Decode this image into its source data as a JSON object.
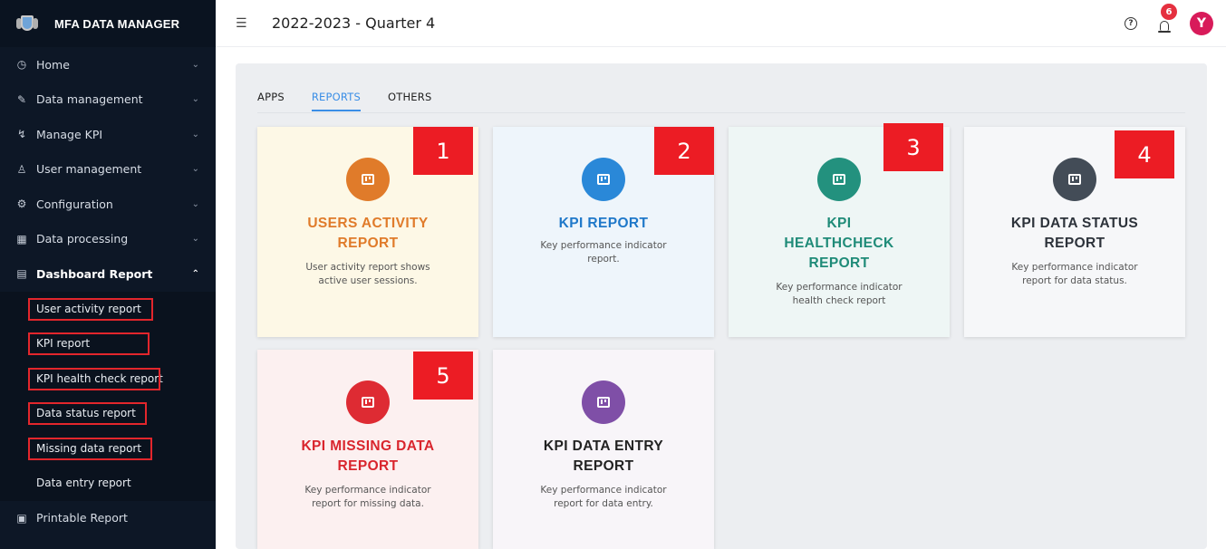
{
  "brand": {
    "title": "MFA DATA MANAGER"
  },
  "topbar": {
    "period": "2022-2023 - Quarter 4",
    "notification_count": "6",
    "avatar_initial": "Y"
  },
  "sidebar": {
    "items": [
      {
        "label": "Home",
        "icon": "clock-icon"
      },
      {
        "label": "Data management",
        "icon": "edit-icon"
      },
      {
        "label": "Manage KPI",
        "icon": "chart-icon"
      },
      {
        "label": "User management",
        "icon": "user-icon"
      },
      {
        "label": "Configuration",
        "icon": "gear-icon"
      },
      {
        "label": "Data processing",
        "icon": "table-icon"
      },
      {
        "label": "Dashboard Report",
        "icon": "report-icon"
      }
    ],
    "subitems": [
      "User activity report",
      "KPI report",
      "KPI health check report",
      "Data status report",
      "Missing data report",
      "Data entry report"
    ],
    "printable": {
      "label": "Printable Report",
      "icon": "printer-icon"
    }
  },
  "tabs": [
    "APPS",
    "REPORTS",
    "OTHERS"
  ],
  "active_tab": "REPORTS",
  "cards": [
    {
      "title": "USERS ACTIVITY REPORT",
      "desc": "User activity report shows active user sessions.",
      "color": "#e07b2a",
      "bg": "#fdf8e6",
      "title_color": "#e07b2a",
      "marker": "1"
    },
    {
      "title": "KPI REPORT",
      "desc": "Key performance indicator report.",
      "color": "#2a88d8",
      "bg": "#eef5fb",
      "title_color": "#1f78c9",
      "marker": "2"
    },
    {
      "title": "KPI HEALTHCHECK REPORT",
      "desc": "Key performance indicator health check report",
      "color": "#23917e",
      "bg": "#eef6f5",
      "title_color": "#1f8b78",
      "marker": "3"
    },
    {
      "title": "KPI DATA STATUS REPORT",
      "desc": "Key performance indicator report for data status.",
      "color": "#434c57",
      "bg": "#f6f7f9",
      "title_color": "#2d333b",
      "marker": "4"
    },
    {
      "title": "KPI MISSING DATA REPORT",
      "desc": "Key performance indicator report for missing data.",
      "color": "#de2b33",
      "bg": "#fcf0f0",
      "title_color": "#d9252d",
      "marker": "5"
    },
    {
      "title": "KPI DATA ENTRY REPORT",
      "desc": "Key performance indicator report for data entry.",
      "color": "#7f4fa7",
      "bg": "#f8f5f9",
      "title_color": "#222222",
      "marker": ""
    }
  ]
}
